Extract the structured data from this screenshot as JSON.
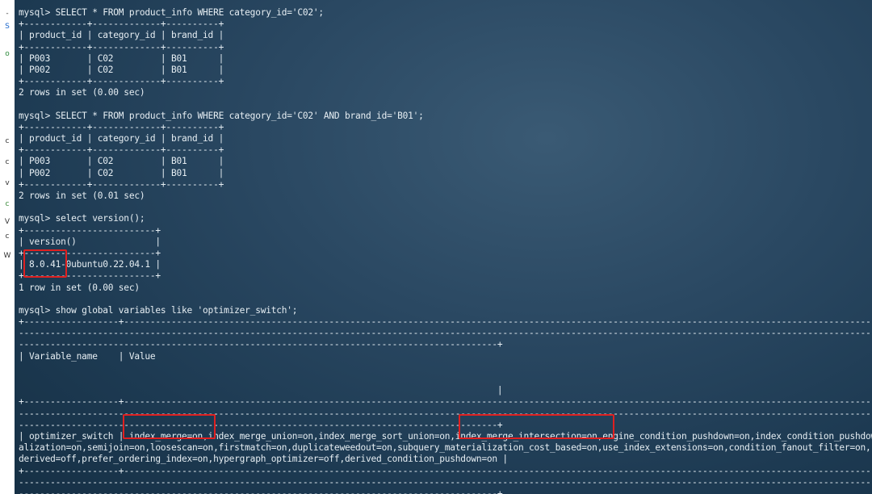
{
  "sidebar": {
    "glyphs": [
      "-",
      "S",
      "o",
      "",
      "",
      "c",
      "c",
      "v",
      "c",
      "V",
      "c",
      "W"
    ],
    "colors": [
      "#444444",
      "#1a66cc",
      "#2d8a3a",
      "#888888",
      "#888888",
      "#333333",
      "#333333",
      "#333333",
      "#3a8a3a",
      "#333333",
      "#333333",
      "#333333"
    ]
  },
  "terminal": {
    "lines": [
      "mysql> SELECT * FROM product_info WHERE category_id='C02';",
      "+------------+-------------+----------+",
      "| product_id | category_id | brand_id |",
      "+------------+-------------+----------+",
      "| P003       | C02         | B01      |",
      "| P002       | C02         | B01      |",
      "+------------+-------------+----------+",
      "2 rows in set (0.00 sec)",
      "",
      "mysql> SELECT * FROM product_info WHERE category_id='C02' AND brand_id='B01';",
      "+------------+-------------+----------+",
      "| product_id | category_id | brand_id |",
      "+------------+-------------+----------+",
      "| P003       | C02         | B01      |",
      "| P002       | C02         | B01      |",
      "+------------+-------------+----------+",
      "2 rows in set (0.01 sec)",
      "",
      "mysql> select version();",
      "+-------------------------+",
      "| version()               |",
      "+-------------------------+",
      "| 8.0.41-0ubuntu0.22.04.1 |",
      "+-------------------------+",
      "1 row in set (0.00 sec)",
      "",
      "mysql> show global variables like 'optimizer_switch';",
      "+------------------+--------------------------------------------------------------------------------------------------------------------------------------------------------------------",
      "------------------------------------------------------------------------------------------------------------------------------------------------------------------------------------",
      "-------------------------------------------------------------------------------------------+",
      "| Variable_name    | Value",
      "",
      "",
      "                                                                                           |",
      "+------------------+--------------------------------------------------------------------------------------------------------------------------------------------------------------------",
      "------------------------------------------------------------------------------------------------------------------------------------------------------------------------------------",
      "-------------------------------------------------------------------------------------------+",
      "| optimizer_switch | index_merge=on,index_merge_union=on,index_merge_sort_union=on,index_merge_intersection=on,engine_condition_pushdown=on,index_condition_pushdown=on,mrr=on,mrr_cost_based=on,block_nested_loop=on,batched_key_access=off,materi",
      "alization=on,semijoin=on,loosescan=on,firstmatch=on,duplicateweedout=on,subquery_materialization_cost_based=on,use_index_extensions=on,condition_fanout_filter=on,",
      "derived=off,prefer_ordering_index=on,hypergraph_optimizer=off,derived_condition_pushdown=on |",
      "+------------------+--------------------------------------------------------------------------------------------------------------------------------------------------------------------",
      "------------------------------------------------------------------------------------------------------------------------------------------------------------------------------------",
      "-------------------------------------------------------------------------------------------+"
    ]
  },
  "highlights": [
    {
      "label": "version 8.0.41"
    },
    {
      "label": "index_merge=on"
    },
    {
      "label": "index_merge_intersection=on"
    }
  ],
  "colors": {
    "highlight": "#e02020",
    "terminal_text": "#e6eef3"
  }
}
